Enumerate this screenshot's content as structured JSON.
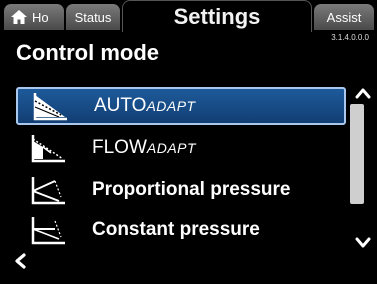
{
  "tabs": {
    "home_label": "Ho",
    "status_label": "Status",
    "settings_label": "Settings",
    "assist_label": "Assist"
  },
  "version": "3.1.4.0.0.0",
  "page_title": "Control mode",
  "items": [
    {
      "main": "AUTO",
      "suffix": "ADAPT",
      "selected": true,
      "icon": "autoadapt-curve-icon"
    },
    {
      "main": "FLOW",
      "suffix": "ADAPT",
      "selected": false,
      "icon": "flowadapt-curve-icon"
    },
    {
      "main": "Proportional pressure",
      "suffix": "",
      "selected": false,
      "icon": "proportional-pressure-curve-icon"
    },
    {
      "main": "Constant pressure",
      "suffix": "",
      "selected": false,
      "icon": "constant-pressure-curve-icon"
    }
  ],
  "colors": {
    "selected_bg": "#1a5290",
    "selected_border": "#aac8ee",
    "background": "#000000"
  },
  "icons": {
    "home": "home-icon",
    "back": "chevron-left-icon",
    "up": "chevron-up-icon",
    "down": "chevron-down-icon"
  }
}
